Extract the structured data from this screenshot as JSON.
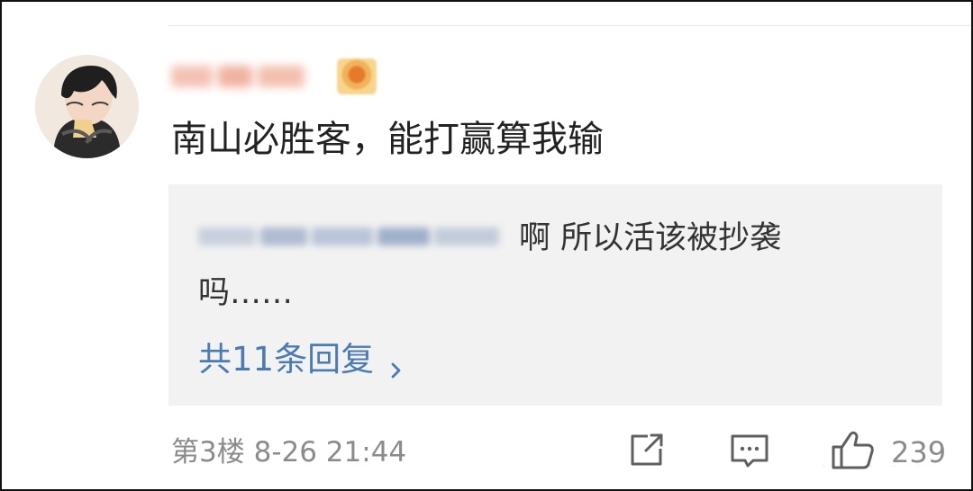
{
  "comment": {
    "username_mosaic": "censored",
    "text": "南山必胜客，能打赢算我输"
  },
  "reply_preview": {
    "author_mosaic": "censored",
    "text_line1": "啊 所以活该被抄袭",
    "text_line2": "吗……",
    "reply_count_label": "共11条回复"
  },
  "footer": {
    "floor_label": "第3楼",
    "timestamp": "8-26 21:44",
    "like_count": "239"
  },
  "icons": {
    "share": "share-icon",
    "comment": "comment-icon",
    "like": "thumb-up-icon",
    "chevron": "chevron-right-icon"
  },
  "colors": {
    "reply_link": "#4a7bb5",
    "meta_gray": "#8b8b8b",
    "reply_bg": "#f2f2f2"
  }
}
